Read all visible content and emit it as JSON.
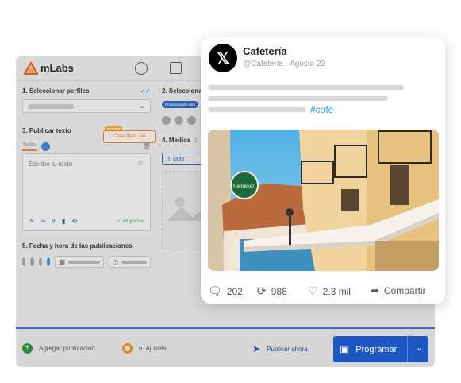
{
  "app": {
    "brand": "mLabs",
    "sections": {
      "profiles_title": "1. Seleccionar perfiles",
      "publish_text_title": "3. Publicar texto",
      "create_title_new_badge": "NUEVO",
      "create_title_button": "Crear título - IA",
      "tab_all": "Todos",
      "text_placeholder": "Escribe tu texto",
      "tags_count": "0 etiquetas",
      "schedule_title": "5. Fecha y hora de las publicaciones",
      "select_partial": "2. Selecciona",
      "programming_chip": "Programación auto",
      "media_title": "4. Medios",
      "media_count": "2",
      "upload_button": "Uplo"
    },
    "footer": {
      "add_publication": "Agregar publicación",
      "settings": "6. Ajustes",
      "publish_now": "Publicar ahora.",
      "schedule_button": "Programar"
    }
  },
  "tweet": {
    "name": "Cafetería",
    "handle_date": "@Cafeteria - Agosto 22",
    "hashtag": "#café",
    "stats": {
      "comments": "202",
      "retweets": "986",
      "likes": "2.3 mil",
      "share": "Compartir"
    },
    "photo_sign": "Heineken"
  },
  "colors": {
    "accent_blue": "#1e56c2",
    "hashtag_blue": "#2f9ad9",
    "orange": "#e07a2c",
    "green": "#2e8b3e"
  }
}
